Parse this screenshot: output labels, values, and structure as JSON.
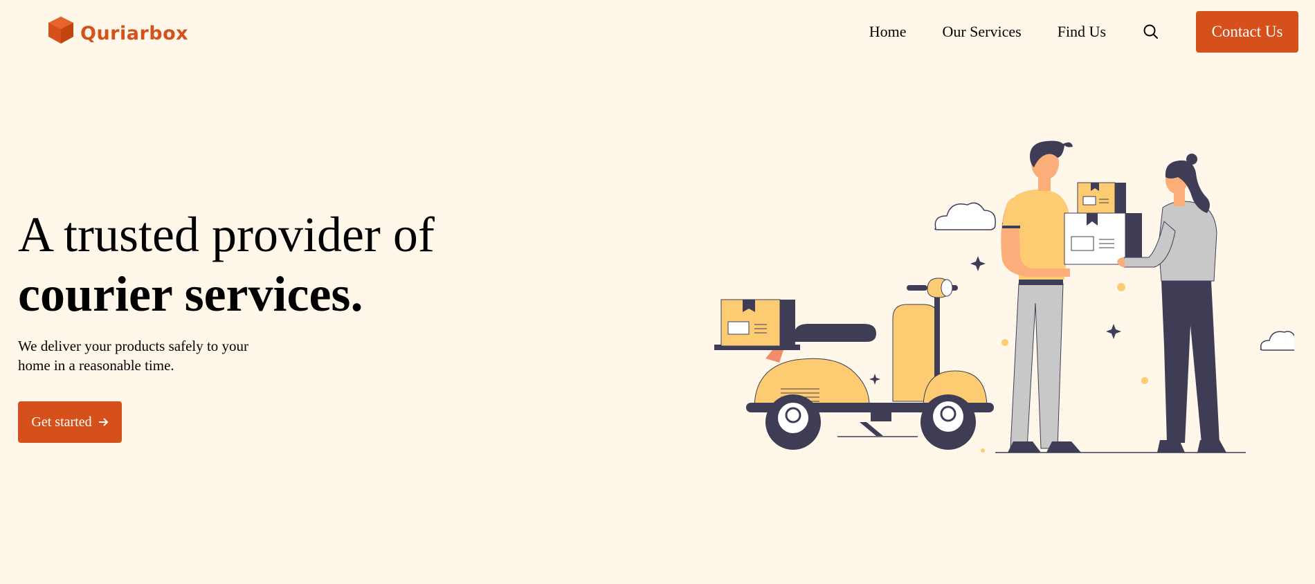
{
  "brand": {
    "name": "Quriarbox",
    "color": "#d6501b"
  },
  "nav": {
    "items": [
      "Home",
      "Our Services",
      "Find Us"
    ],
    "search_icon": "search-icon",
    "contact_label": "Contact Us"
  },
  "hero": {
    "title_line1": "A trusted provider of",
    "title_line2": "courier services.",
    "subtitle": "We deliver your products safely to your home in a reasonable time.",
    "cta_label": "Get started",
    "cta_icon": "arrow-right-icon"
  },
  "colors": {
    "background": "#fff8ea",
    "accent": "#d6501b",
    "illustration_yellow": "#fdcb72",
    "illustration_dark": "#3f3d56"
  }
}
